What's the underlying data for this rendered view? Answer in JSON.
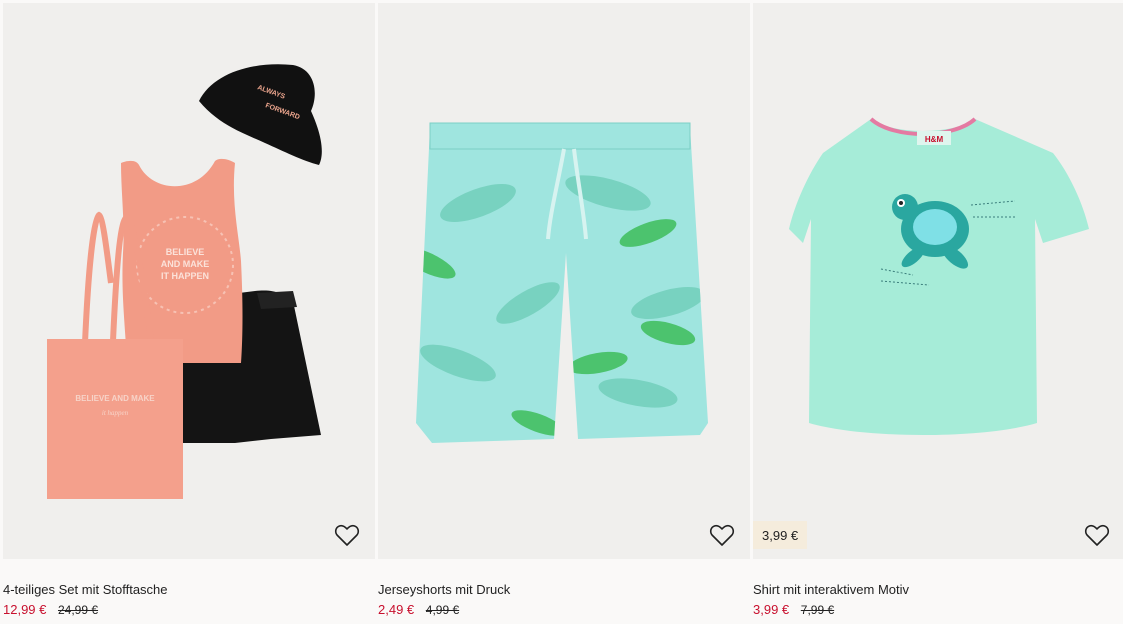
{
  "colors": {
    "sale_price": "#c8102e",
    "image_bg": "#f0efed",
    "badge_bg": "#f5ecdc"
  },
  "products": [
    {
      "name": "4-teiliges Set mit Stofftasche",
      "price": "12,99 €",
      "old_price": "24,99 €",
      "hat_text": [
        "ALWAYS",
        "FORWARD"
      ],
      "shirt_text": [
        "BELIEVE",
        "AND MAKE",
        "IT HAPPEN"
      ],
      "bag_text": [
        "BELIEVE AND MAKE",
        "it happen"
      ],
      "favorite_icon": "heart-outline-icon"
    },
    {
      "name": "Jerseyshorts mit Druck",
      "price": "2,49 €",
      "old_price": "4,99 €",
      "favorite_icon": "heart-outline-icon"
    },
    {
      "name": "Shirt mit interaktivem Motiv",
      "price": "3,99 €",
      "old_price": "7,99 €",
      "badge": "3,99 €",
      "tag_text": "H&M",
      "favorite_icon": "heart-outline-icon"
    }
  ]
}
